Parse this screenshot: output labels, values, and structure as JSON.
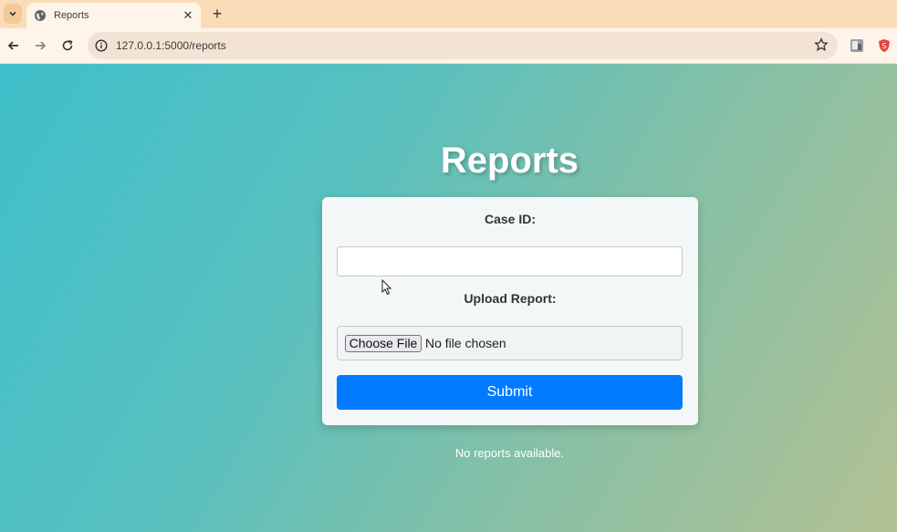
{
  "browser": {
    "tab": {
      "title": "Reports"
    },
    "new_tab_symbol": "+",
    "address": {
      "url": "127.0.0.1:5000/reports"
    }
  },
  "page": {
    "heading": "Reports",
    "form": {
      "case_id_label": "Case ID:",
      "case_id_value": "",
      "upload_label": "Upload Report:",
      "choose_file_label": "Choose File",
      "no_file_text": "No file chosen",
      "submit_label": "Submit"
    },
    "status_message": "No reports available."
  },
  "colors": {
    "tabstrip": "#fbdcb8",
    "toolbar": "#fff4ea",
    "submit_button": "#007bff",
    "gradient_start": "#3fbfca",
    "gradient_end": "#b3c193"
  }
}
